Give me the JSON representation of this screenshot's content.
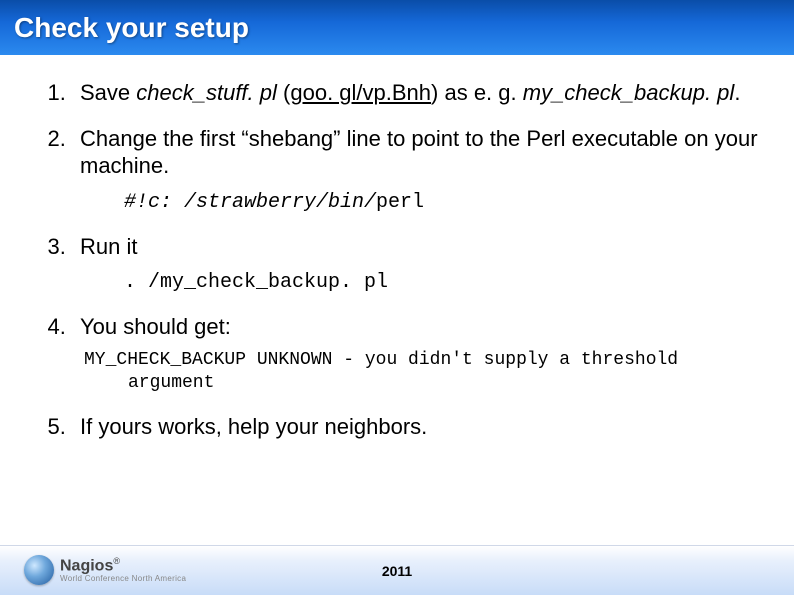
{
  "header": {
    "title": "Check your setup"
  },
  "items": {
    "i1_prefix": "Save ",
    "i1_file": "check_stuff. pl",
    "i1_mid": " (",
    "i1_link": "goo. gl/vp.Bnh",
    "i1_aft": ") as e. g. ",
    "i1_file2": "my_check_backup. pl",
    "i1_end": ".",
    "i2": "Change the first “shebang” line to point to the Perl executable on your machine.",
    "i2_code_italic": "#!c: /strawberry/bin/",
    "i2_code_plain": "perl",
    "i3": "Run it",
    "i3_code": ". /my_check_backup. pl",
    "i4": "You should get:",
    "i4_out_line1": "MY_CHECK_BACKUP UNKNOWN -  you didn't supply a threshold",
    "i4_out_line2": "argument",
    "i5": "If yours works, help your neighbors."
  },
  "footer": {
    "brand": "Nagios",
    "sub": "World Conference   North America",
    "year": "2011"
  }
}
